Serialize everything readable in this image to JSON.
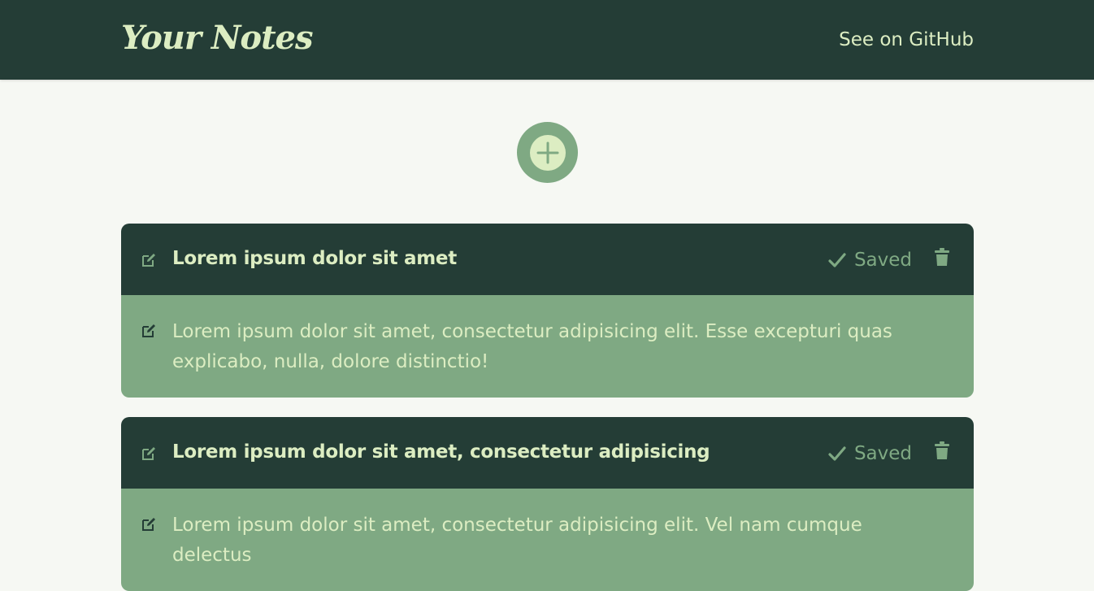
{
  "header": {
    "logo": "Your Notes",
    "github_link": "See on GitHub"
  },
  "add_button": {
    "icon": "plus-icon"
  },
  "notes": [
    {
      "title": "Lorem ipsum dolor sit amet",
      "status": "Saved",
      "body": "Lorem ipsum dolor sit amet, consectetur adipisicing elit. Esse excepturi quas explicabo, nulla, dolore distinctio!"
    },
    {
      "title": "Lorem ipsum dolor sit amet, consectetur adipisicing",
      "status": "Saved",
      "body": "Lorem ipsum dolor sit amet, consectetur adipisicing elit. Vel nam cumque delectus"
    }
  ],
  "colors": {
    "dark": "#243d36",
    "accent": "#7fa983",
    "light": "#dcedc2",
    "background": "#f6f8f3"
  }
}
